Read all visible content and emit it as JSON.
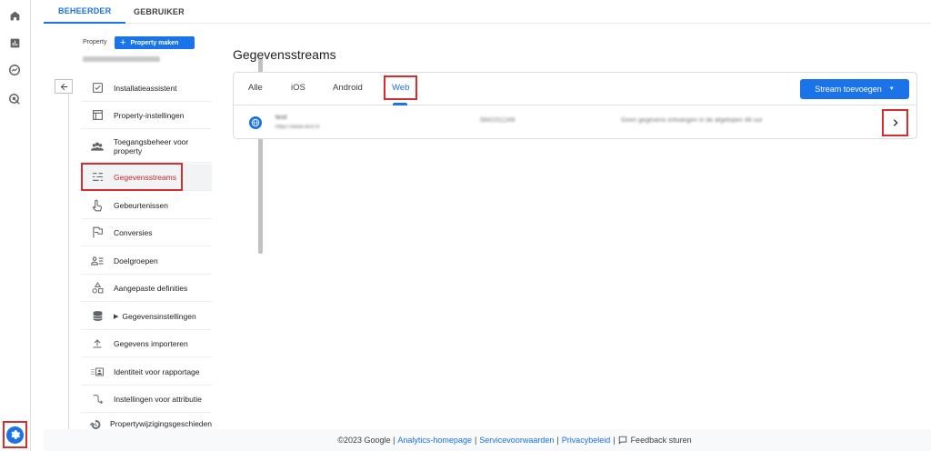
{
  "top_tabs": [
    {
      "label": "BEHEERDER",
      "active": true
    },
    {
      "label": "GEBRUIKER",
      "active": false
    }
  ],
  "sidebar": {
    "property_label": "Property",
    "property_button": "Property maken",
    "items": [
      {
        "label": "Installatieassistent",
        "icon": "checklist-icon"
      },
      {
        "label": "Property-instellingen",
        "icon": "settings-page-icon"
      },
      {
        "label": "Toegangsbeheer voor property",
        "icon": "people-icon"
      },
      {
        "label": "Gegevensstreams",
        "icon": "streams-icon",
        "selected": true
      },
      {
        "label": "Gebeurtenissen",
        "icon": "touch-icon"
      },
      {
        "label": "Conversies",
        "icon": "flag-icon"
      },
      {
        "label": "Doelgroepen",
        "icon": "audience-icon"
      },
      {
        "label": "Aangepaste definities",
        "icon": "shapes-icon"
      },
      {
        "label": "Gegevensinstellingen",
        "icon": "database-icon",
        "expandable": true
      },
      {
        "label": "Gegevens importeren",
        "icon": "upload-icon"
      },
      {
        "label": "Identiteit voor rapportage",
        "icon": "identity-icon"
      },
      {
        "label": "Instellingen voor attributie",
        "icon": "attribution-icon"
      },
      {
        "label": "Propertywijzigingsgeschieden",
        "icon": "history-icon"
      }
    ]
  },
  "main": {
    "title": "Gegevensstreams",
    "tabs": [
      {
        "label": "Alle",
        "active": false
      },
      {
        "label": "iOS",
        "active": false
      },
      {
        "label": "Android",
        "active": false
      },
      {
        "label": "Web",
        "active": true
      }
    ],
    "add_stream_button": "Stream toevoegen",
    "stream": {
      "name": "test",
      "url": "https://www.test.nl",
      "id": "5841011249",
      "status": "Geen gegevens ontvangen in de afgelopen 48 uur"
    }
  },
  "footer": {
    "copyright": "©2023 Google |",
    "links": [
      "Analytics-homepage",
      "Servicevoorwaarden",
      "Privacybeleid"
    ],
    "feedback": "Feedback sturen"
  },
  "colors": {
    "accent": "#1a73e8",
    "highlight": "#d32f2f"
  }
}
